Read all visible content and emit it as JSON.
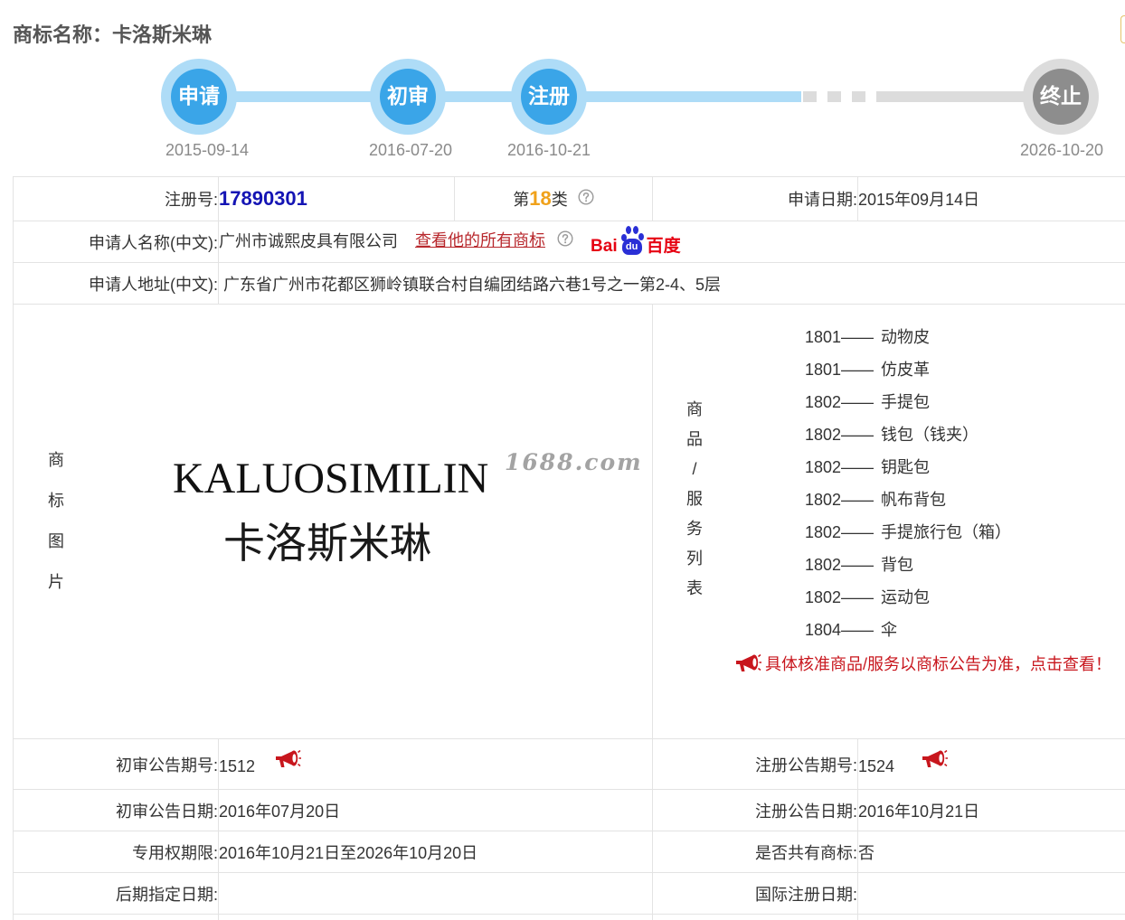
{
  "header": {
    "title": "商标名称：卡洛斯米琳"
  },
  "timeline": {
    "steps": [
      {
        "label": "申请",
        "date": "2015-09-14",
        "completed": true
      },
      {
        "label": "初审",
        "date": "2016-07-20",
        "completed": true
      },
      {
        "label": "注册",
        "date": "2016-10-21",
        "completed": true
      },
      {
        "label": "终止",
        "date": "2026-10-20",
        "completed": false
      }
    ],
    "colors": {
      "completed": "#3aa5e8",
      "completed_ring": "#aedcf7",
      "pending": "#8d8d8d",
      "pending_ring": "#dcdcdc"
    }
  },
  "reg_no": {
    "label": "注册号:",
    "value": "17890301",
    "color": "#1414b4"
  },
  "class": {
    "prefix": "第",
    "number": "18",
    "suffix": "类",
    "color": "#f0a11a"
  },
  "apply_date": {
    "label": "申请日期:",
    "value": "2015年09月14日"
  },
  "applicant_name": {
    "label": "申请人名称(中文):",
    "value": "广州市诚熙皮具有限公司",
    "all_marks_link": "查看他的所有商标",
    "link_color": "#b8282d",
    "baidu_logo": {
      "left": "Bai",
      "paw": "du",
      "right": "百度"
    }
  },
  "applicant_address": {
    "label": "申请人地址(中文):",
    "value": "广东省广州市花都区狮岭镇联合村自编团结路六巷1号之一第2-4、5层"
  },
  "mark_image": {
    "label_chars": [
      "商",
      "标",
      "图",
      "片"
    ],
    "english": "KALUOSIMILIN",
    "chinese": "卡洛斯米琳",
    "watermark": "1688.com"
  },
  "services": {
    "label_chars": [
      "商",
      "品",
      "/",
      "服",
      "务",
      "列",
      "表"
    ],
    "separator": "——",
    "items": [
      {
        "code": "1801",
        "name": "动物皮"
      },
      {
        "code": "1801",
        "name": "仿皮革"
      },
      {
        "code": "1802",
        "name": "手提包"
      },
      {
        "code": "1802",
        "name": "钱包（钱夹）"
      },
      {
        "code": "1802",
        "name": "钥匙包"
      },
      {
        "code": "1802",
        "name": "帆布背包"
      },
      {
        "code": "1802",
        "name": "手提旅行包（箱）"
      },
      {
        "code": "1802",
        "name": "背包"
      },
      {
        "code": "1802",
        "name": "运动包"
      },
      {
        "code": "1804",
        "name": "伞"
      }
    ],
    "notice": "具体核准商品/服务以商标公告为准，点击查看！",
    "notice_color": "#c8161d"
  },
  "publication": {
    "prelim_no": {
      "label": "初审公告期号:",
      "value": "1512"
    },
    "reg_no": {
      "label": "注册公告期号:",
      "value": "1524"
    },
    "prelim_date": {
      "label": "初审公告日期:",
      "value": "2016年07月20日"
    },
    "reg_date": {
      "label": "注册公告日期:",
      "value": "2016年10月21日"
    },
    "exclusive_term": {
      "label": "专用权期限:",
      "value": "2016年10月21日至2026年10月20日"
    },
    "shared_mark": {
      "label": "是否共有商标:",
      "value": "否"
    },
    "later_designation_date": {
      "label": "后期指定日期:",
      "value": ""
    },
    "intl_reg_date": {
      "label": "国际注册日期:",
      "value": ""
    }
  },
  "icons": {
    "help": "question-circle-icon",
    "announcement": "megaphone-icon",
    "search_engine": "baidu-logo"
  }
}
